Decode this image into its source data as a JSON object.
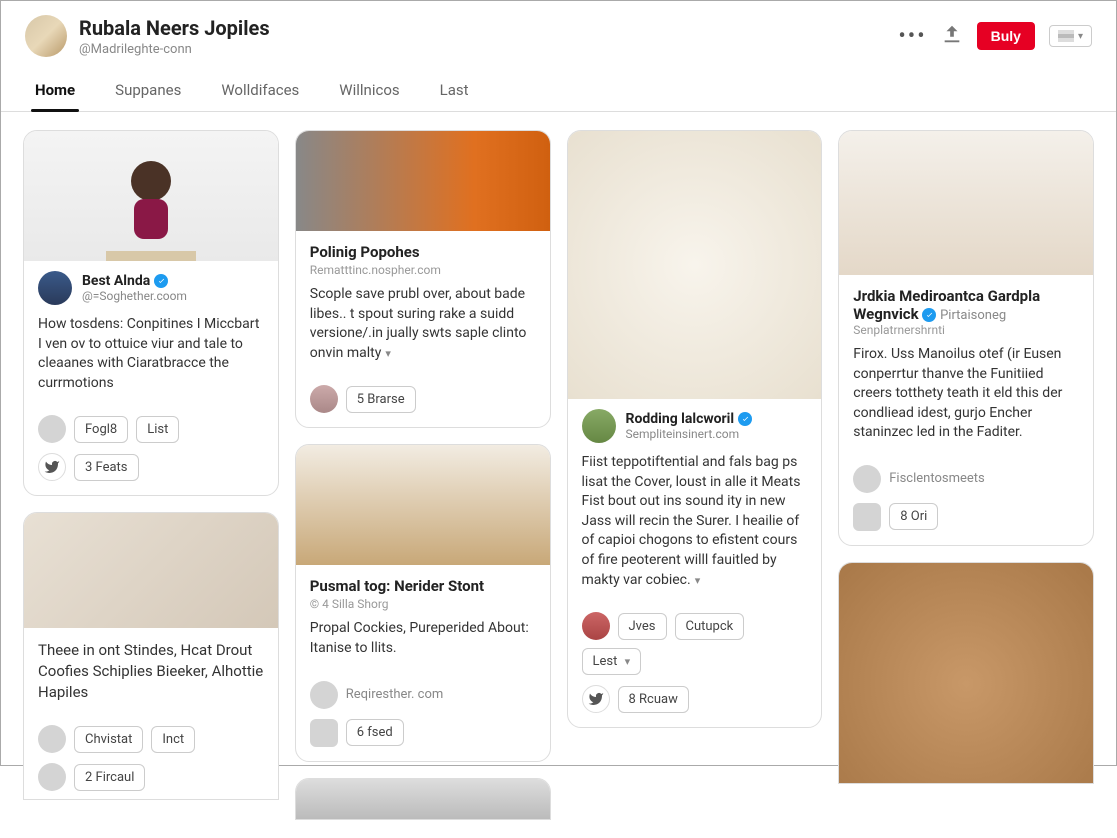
{
  "header": {
    "title": "Rubala Neers Jopiles",
    "handle": "@Madrileghte-conn",
    "buy_label": "Buly"
  },
  "tabs": [
    {
      "label": "Home",
      "active": true
    },
    {
      "label": "Suppanes",
      "active": false
    },
    {
      "label": "Wolldifaces",
      "active": false
    },
    {
      "label": "Willnicos",
      "active": false
    },
    {
      "label": "Last",
      "active": false
    }
  ],
  "col1": {
    "card_a": {
      "user_name": "Best Alnda",
      "user_sub": "@=Soghether.coom",
      "text": "How tosdens: Conpitines I Miccbart I ven ov to ottuice viur and tale to cleaanes with Ciaratbracce the currmotions",
      "chip1": "Fogl8",
      "chip2": "List",
      "feats": "3  Feats"
    },
    "card_b": {
      "title": "Theee in ont Stindes, Hcat Drout Coofies Schiplies Bieeker, Alhottie Hapiles",
      "chip1": "Chvistat",
      "chip2": "Inct",
      "feats": "2  Fircaul"
    }
  },
  "col2": {
    "card_a": {
      "title": "Polinig Popohes",
      "sub": "Rematttinc.nospher.com",
      "text": "Scople save prubl over, about bade libes.. t spout suring rake a suidd versione/.in jually swts saple clinto onvin malty",
      "chip": "5  Brarse"
    },
    "card_b": {
      "title": "Pusmal tog: Nerider Stont",
      "sub": "© 4 Silla Shorg",
      "text": "Propal Cockies, Pureperided About: Itanise to llits.",
      "source": "Reqiresther. com",
      "chip": "6  fsed"
    }
  },
  "col3": {
    "card_a": {
      "user_name": "Rodding lalcworil",
      "user_sub": "Sempliteinsinert.com",
      "text": "Fiist teppotiftential and fals bag ps lisat the Cover, loust in alle it Meats Fist bout out ins sound ity in new Jass will recin the Surer. I heailie of of capioi chogons to efistent cours of fire peoterent willl fauitled by makty var cobiec.",
      "chip1": "Jves",
      "chip2": "Cutupck",
      "chip3": "Lest",
      "feats": "8  Rcuaw"
    }
  },
  "col4": {
    "card_a": {
      "title": "Jrdkia Mediroantca Gardpla Wegnvick",
      "badge_text": "Pirtaisoneg",
      "sub": "Senplatrnershrnti",
      "text": "Firox. Uss Manoilus otef (ir Eusen conperrtur thanve the Funitiied creers totthety teath it eld this der condliead idest, gurjo Encher staninzec led in the Faditer.",
      "source": "Fisclentosmeets",
      "chip": "8  Ori"
    }
  }
}
